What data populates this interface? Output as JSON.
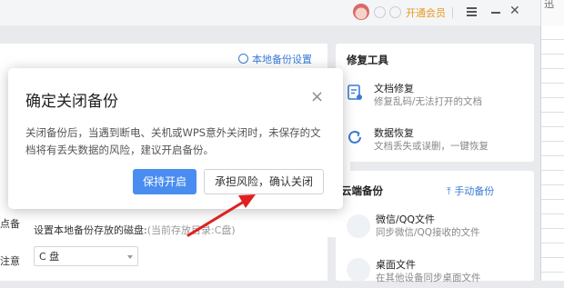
{
  "topbar": {
    "vip_label": "开通会员",
    "right_edge_text": "迅"
  },
  "panel": {
    "local_backup_settings": "本地备份设置",
    "disk_label": "设置本地备份存放的磁盘:",
    "disk_hint": "(当前存放目录:C盘)",
    "disk_value": "C 盘",
    "cut_text_1": "点备",
    "cut_text_2": "注意"
  },
  "tools": {
    "title": "修复工具",
    "items": [
      {
        "title": "文档修复",
        "desc": "修复乱码/无法打开的文档",
        "icon": "document-repair-icon"
      },
      {
        "title": "数据恢复",
        "desc": "文档丢失或误删，一键恢复",
        "icon": "data-recovery-icon"
      }
    ]
  },
  "cloud": {
    "title": "云端备份",
    "manual_backup": "手动备份",
    "items": [
      {
        "title": "微信/QQ文件",
        "desc": "同步微信/QQ接收的文件"
      },
      {
        "title": "桌面文件",
        "desc": "在其他设备同步桌面文件"
      }
    ]
  },
  "modal": {
    "title": "确定关闭备份",
    "close_symbol": "×",
    "message": "关闭备份后，当遇到断电、关机或WPS意外关闭时，未保存的文档将有丢失数据的风险，建议开启备份。",
    "keep_on_label": "保持开启",
    "confirm_close_label": "承担风险，确认关闭"
  },
  "colors": {
    "accent_blue": "#4a8df0",
    "vip_orange": "#e69a1e",
    "annotation_red": "#e02020"
  }
}
